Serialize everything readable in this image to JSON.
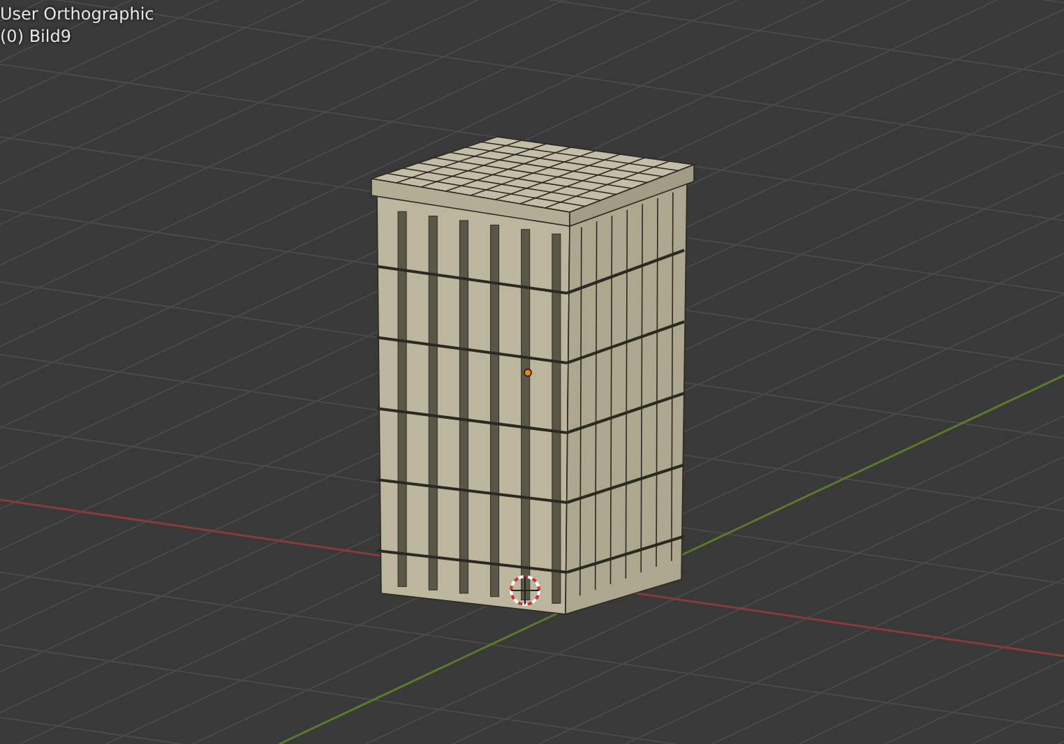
{
  "viewport": {
    "view_name": "User Orthographic",
    "object_label": "(0) Bild9"
  }
}
